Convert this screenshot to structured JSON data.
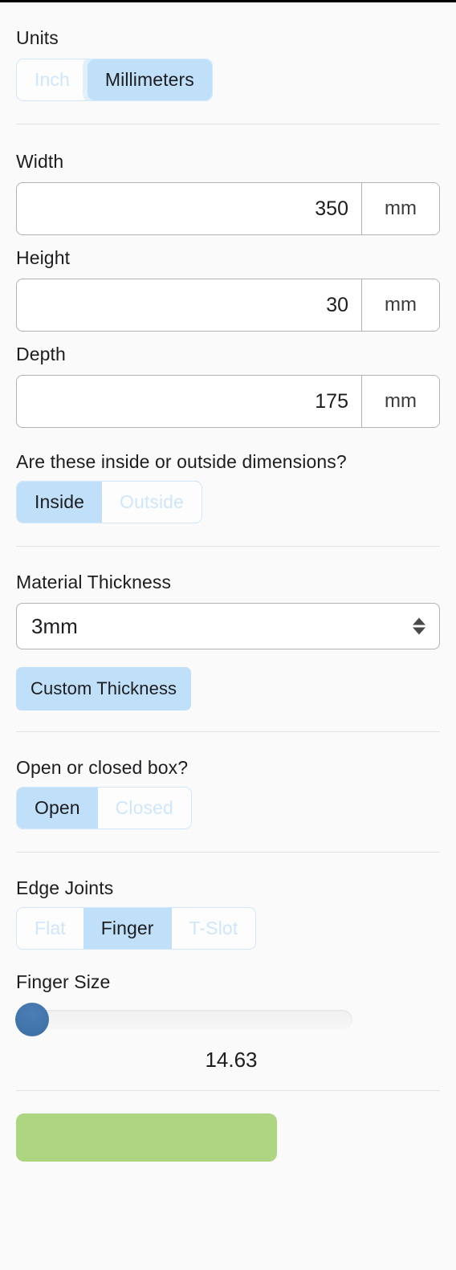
{
  "units": {
    "label": "Units",
    "options": [
      {
        "label": "Inch",
        "selected": false
      },
      {
        "label": "Millimeters",
        "selected": true
      }
    ],
    "selected": "Millimeters"
  },
  "dimensions": {
    "width": {
      "label": "Width",
      "value": "350",
      "unit": "mm"
    },
    "height": {
      "label": "Height",
      "value": "30",
      "unit": "mm"
    },
    "depth": {
      "label": "Depth",
      "value": "175",
      "unit": "mm"
    }
  },
  "inside_outside": {
    "label": "Are these inside or outside dimensions?",
    "options": [
      {
        "label": "Inside",
        "selected": true
      },
      {
        "label": "Outside",
        "selected": false
      }
    ],
    "selected": "Inside"
  },
  "material_thickness": {
    "label": "Material Thickness",
    "value": "3mm",
    "options": [
      "3mm"
    ],
    "custom_button": "Custom Thickness",
    "stepper_icon": "up-down-chevron-icon"
  },
  "box_style": {
    "label": "Open or closed box?",
    "options": [
      {
        "label": "Open",
        "selected": true
      },
      {
        "label": "Closed",
        "selected": false
      }
    ],
    "selected": "Open"
  },
  "edge_joints": {
    "label": "Edge Joints",
    "options": [
      {
        "label": "Flat",
        "selected": false
      },
      {
        "label": "Finger",
        "selected": true
      },
      {
        "label": "T-Slot",
        "selected": false
      }
    ],
    "selected": "Finger"
  },
  "finger_size": {
    "label": "Finger Size",
    "value": "14.63",
    "thumb_position_pct": 0
  },
  "primary_action": {
    "label": ""
  },
  "colors": {
    "accent_selected": "#bfe0f8",
    "accent_border": "#cfe6fb",
    "accent_text_muted": "#cfe6fb",
    "slider_thumb": "#3d72ab",
    "primary_action": "#aed581",
    "page_background": "#fafafa",
    "input_border": "#b3b3b3",
    "divider": "#e2e2e2"
  }
}
